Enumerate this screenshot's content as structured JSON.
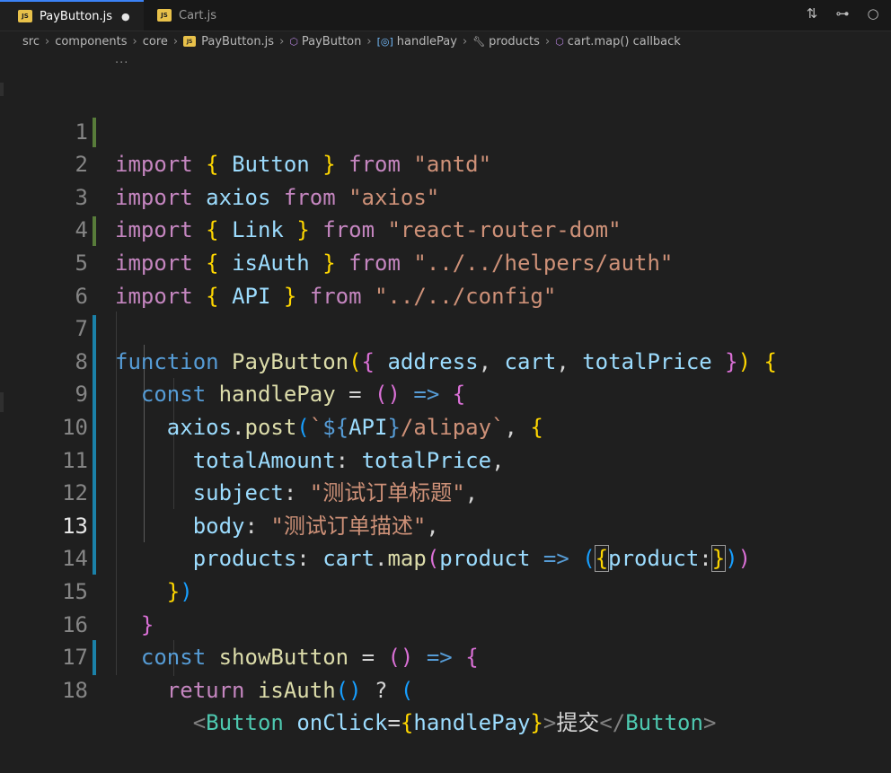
{
  "tabs": [
    {
      "name": "PayButton.js",
      "icon": "js-file-icon",
      "active": true,
      "modified": true
    },
    {
      "name": "Cart.js",
      "icon": "js-file-icon",
      "active": false,
      "modified": false
    }
  ],
  "tab_actions": [
    "compare-changes-icon",
    "source-control-icon",
    "go-to-icon"
  ],
  "breadcrumb": [
    "src",
    "components",
    "core",
    "PayButton.js",
    "PayButton",
    "handlePay",
    "products",
    "cart.map() callback"
  ],
  "editor": {
    "collapsed_indicator": "···",
    "current_line": 13,
    "lines": [
      {
        "n": "1",
        "text": "import { Button } from \"antd\""
      },
      {
        "n": "2",
        "text": "import axios from \"axios\""
      },
      {
        "n": "3",
        "text": "import { Link } from \"react-router-dom\""
      },
      {
        "n": "4",
        "text": "import { isAuth } from \"../../helpers/auth\""
      },
      {
        "n": "5",
        "text": "import { API } from \"../../config\""
      },
      {
        "n": "6",
        "text": ""
      },
      {
        "n": "7",
        "text": "function PayButton({ address, cart, totalPrice }) {"
      },
      {
        "n": "8",
        "text": "  const handlePay = () => {"
      },
      {
        "n": "9",
        "text": "    axios.post(`${API}/alipay`, {"
      },
      {
        "n": "10",
        "text": "      totalAmount: totalPrice,"
      },
      {
        "n": "11",
        "text": "      subject: \"测试订单标题\","
      },
      {
        "n": "12",
        "text": "      body: \"测试订单描述\","
      },
      {
        "n": "13",
        "text": "      products: cart.map(product => ({product:}))"
      },
      {
        "n": "14",
        "text": "    })"
      },
      {
        "n": "15",
        "text": "  }"
      },
      {
        "n": "16",
        "text": "  const showButton = () => {"
      },
      {
        "n": "17",
        "text": "    return isAuth() ? ("
      },
      {
        "n": "18",
        "text": "      <Button onClick={handlePay}>提交</Button>"
      }
    ]
  }
}
